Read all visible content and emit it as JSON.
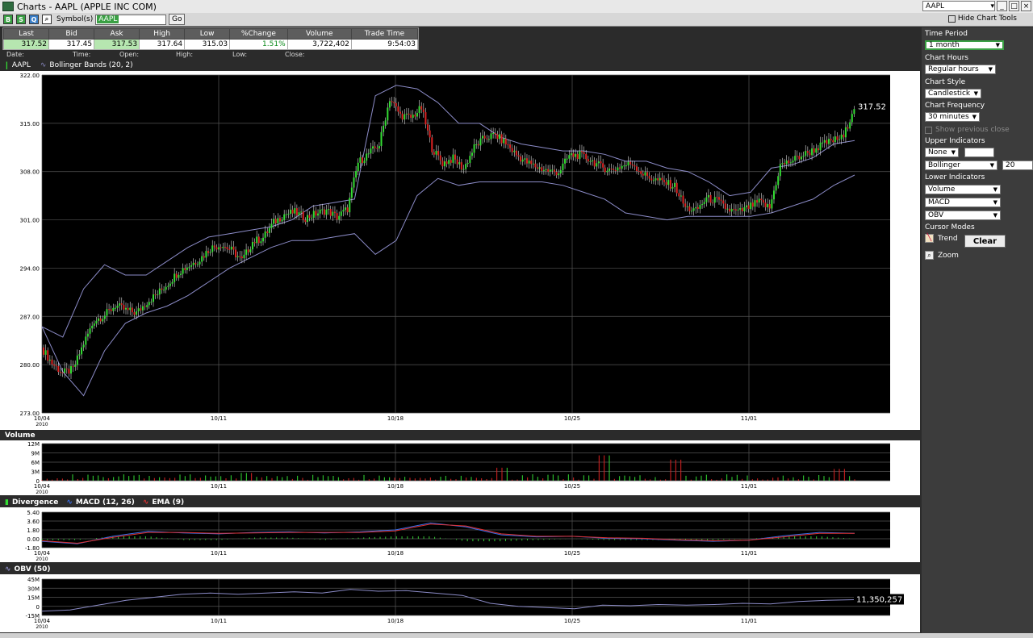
{
  "window": {
    "title": "Charts - AAPL (APPLE INC COM)",
    "symbol_select": "AAPL"
  },
  "toolbar": {
    "symbol_label": "Symbol(s)",
    "symbol_value": "AAPL",
    "go_label": "Go",
    "hide_tools_label": "Hide Chart Tools"
  },
  "quote": {
    "headers": [
      "Last",
      "Bid",
      "Ask",
      "High",
      "Low",
      "%Change",
      "Volume",
      "Trade Time"
    ],
    "values": [
      "317.52",
      "317.45",
      "317.53",
      "317.64",
      "315.03",
      "1.51%",
      "3,722,402",
      "9:54:03"
    ]
  },
  "info": {
    "date": "Date:",
    "time": "Time:",
    "open": "Open:",
    "high": "High:",
    "low": "Low:",
    "close": "Close:"
  },
  "legend": {
    "symbol": "AAPL",
    "bollinger": "Bollinger Bands (20, 2)"
  },
  "panels": {
    "volume": "Volume",
    "divergence": "Divergence",
    "macd": "MACD (12, 26)",
    "ema": "EMA (9)",
    "obv": "OBV (50)"
  },
  "side": {
    "time_period_label": "Time Period",
    "time_period": "1 month",
    "chart_hours_label": "Chart Hours",
    "chart_hours": "Regular hours",
    "chart_style_label": "Chart Style",
    "chart_style": "Candlestick",
    "chart_frequency_label": "Chart Frequency",
    "chart_frequency": "30 minutes",
    "show_previous_close": "Show previous close",
    "upper_indicators_label": "Upper Indicators",
    "upper_1": "None",
    "upper_2": "Bollinger",
    "upper_2_param": "20",
    "lower_indicators_label": "Lower Indicators",
    "lower_1": "Volume",
    "lower_2": "MACD",
    "lower_3": "OBV",
    "cursor_modes_label": "Cursor Modes",
    "trend_label": "Trend",
    "clear_label": "Clear",
    "zoom_label": "Zoom"
  },
  "colors": {
    "up": "#33dd33",
    "down": "#dd2222",
    "band": "#8c8cc8",
    "macd": "#3a6ee8",
    "ema": "#e03030"
  },
  "chart_data": [
    {
      "type": "candlestick",
      "name": "AAPL",
      "ylim": [
        273,
        322
      ],
      "yticks": [
        "322.00",
        "315.00",
        "308.00",
        "301.00",
        "294.00",
        "287.00",
        "280.00",
        "273.00"
      ],
      "xticks": [
        "10/04\n2010",
        "10/11",
        "10/18",
        "10/25",
        "11/01"
      ],
      "last_label": "317.52",
      "closes": [
        282.5,
        280.2,
        278.8,
        279.3,
        283.1,
        286.4,
        287.2,
        288.6,
        287.9,
        287.5,
        289.1,
        290.3,
        291.8,
        293.5,
        294.4,
        295.3,
        296.9,
        297.4,
        296.6,
        295.1,
        297.8,
        298.4,
        300.6,
        301.8,
        302.1,
        301.3,
        301.9,
        302.4,
        301.4,
        302.6,
        309.3,
        310.6,
        311.9,
        318.6,
        316.2,
        315.8,
        317.2,
        311.4,
        309.2,
        309.9,
        308.4,
        311.5,
        312.9,
        313.3,
        312.1,
        310.4,
        309.3,
        308.6,
        308.1,
        307.9,
        310.3,
        310.4,
        309.7,
        308.7,
        308.2,
        308.8,
        309.2,
        307.6,
        306.9,
        306.4,
        305.9,
        302.8,
        302.3,
        304.1,
        303.8,
        302.5,
        302.1,
        302.8,
        303.6,
        302.7,
        308.9,
        309.5,
        310.3,
        311.0,
        311.9,
        312.5,
        313.0,
        317.52
      ],
      "upper_band": [
        285.5,
        284.0,
        291.0,
        294.5,
        293.0,
        293.0,
        295.0,
        297.0,
        298.5,
        299.0,
        299.5,
        300.0,
        301.0,
        303.0,
        303.5,
        304.0,
        319.0,
        320.5,
        320.0,
        318.0,
        315.0,
        315.0,
        313.0,
        312.0,
        311.5,
        311.0,
        311.0,
        310.5,
        309.5,
        309.5,
        308.5,
        308.0,
        306.5,
        304.5,
        305.0,
        308.5,
        309.0,
        310.0,
        312.0,
        312.5
      ],
      "lower_band": [
        285.5,
        279.0,
        275.5,
        282.0,
        286.0,
        287.5,
        288.5,
        290.0,
        292.0,
        294.0,
        295.5,
        297.0,
        298.0,
        298.0,
        298.5,
        299.0,
        296.0,
        298.0,
        304.5,
        307.0,
        306.0,
        306.5,
        306.5,
        306.5,
        306.5,
        306.0,
        305.0,
        304.0,
        302.0,
        301.5,
        301.0,
        301.5,
        301.5,
        301.5,
        301.5,
        302.0,
        303.0,
        304.0,
        306.0,
        307.5
      ]
    },
    {
      "type": "bar",
      "name": "Volume",
      "ylim": [
        0,
        12
      ],
      "yticks": [
        "12M",
        "9M",
        "6M",
        "3M",
        "0"
      ],
      "spikes": [
        [
          20,
          2.5
        ],
        [
          45,
          4.2
        ],
        [
          55,
          8.2
        ],
        [
          62,
          6.8
        ],
        [
          78,
          3.8
        ]
      ]
    },
    {
      "type": "line",
      "name": "MACD",
      "ylim": [
        -1.8,
        5.4
      ],
      "yticks": [
        "5.40",
        "3.60",
        "1.80",
        "0.00",
        "-1.80"
      ],
      "macd": [
        -0.5,
        -1.0,
        0.5,
        1.5,
        1.2,
        1.0,
        1.3,
        1.4,
        1.2,
        1.4,
        1.8,
        3.2,
        2.4,
        0.8,
        0.4,
        0.5,
        0.1,
        0.0,
        -0.3,
        -0.5,
        -0.3,
        0.6,
        1.3,
        1.1
      ],
      "ema": [
        -0.4,
        -0.9,
        0.3,
        1.3,
        1.3,
        1.1,
        1.2,
        1.3,
        1.3,
        1.3,
        1.6,
        3.0,
        2.6,
        1.0,
        0.5,
        0.5,
        0.2,
        0.1,
        -0.2,
        -0.4,
        -0.3,
        0.4,
        1.1,
        1.1
      ]
    },
    {
      "type": "line",
      "name": "OBV",
      "ylim": [
        -15,
        45
      ],
      "yticks": [
        "45M",
        "30M",
        "15M",
        "0",
        "-15M"
      ],
      "last_label": "11,350,257",
      "values": [
        -8,
        -6,
        2,
        10,
        15,
        20,
        22,
        20,
        22,
        24,
        22,
        28,
        25,
        26,
        22,
        18,
        5,
        0,
        -2,
        -4,
        2,
        1,
        3,
        2,
        3,
        5,
        4,
        8,
        10,
        11
      ]
    }
  ]
}
